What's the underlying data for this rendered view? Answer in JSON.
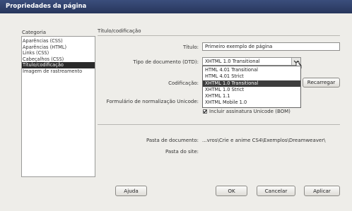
{
  "window": {
    "title": "Propriedades da página"
  },
  "sidebar": {
    "heading": "Categoria",
    "items": [
      {
        "label": "Aparências (CSS)"
      },
      {
        "label": "Aparências (HTML)"
      },
      {
        "label": "Links (CSS)"
      },
      {
        "label": "Cabeçalhos (CSS)"
      },
      {
        "label": "Título/codificação",
        "selected": true
      },
      {
        "label": "Imagem de rastreamento"
      }
    ]
  },
  "section": {
    "title": "Título/codificação"
  },
  "form": {
    "title_label": "Título:",
    "title_value": "Primeiro exemplo de página",
    "doctype_label": "Tipo de documento (DTD):",
    "doctype_value": "XHTML 1.0 Transitional",
    "doctype_options": [
      "HTML 4.01 Transitional",
      "HTML 4.01 Strict",
      "XHTML 1.0 Transitional",
      "XHTML 1.0 Strict",
      "XHTML 1.1",
      "XHTML Mobile 1.0"
    ],
    "doctype_selected_index": 2,
    "encoding_label": "Codificação:",
    "reload_button": "Recarregar",
    "normalization_label": "Formulário de normalização Unicode:",
    "signature_label": "Incluir assinatura Unicode (BOM)",
    "signature_checked": true,
    "doc_folder_label": "Pasta de documento:",
    "doc_folder_value": "...vros\\Crie e anime CS4\\Exemplos\\Dreamweaver\\",
    "site_folder_label": "Pasta do site:"
  },
  "buttons": {
    "help": "Ajuda",
    "ok": "OK",
    "cancel": "Cancelar",
    "apply": "Aplicar"
  }
}
